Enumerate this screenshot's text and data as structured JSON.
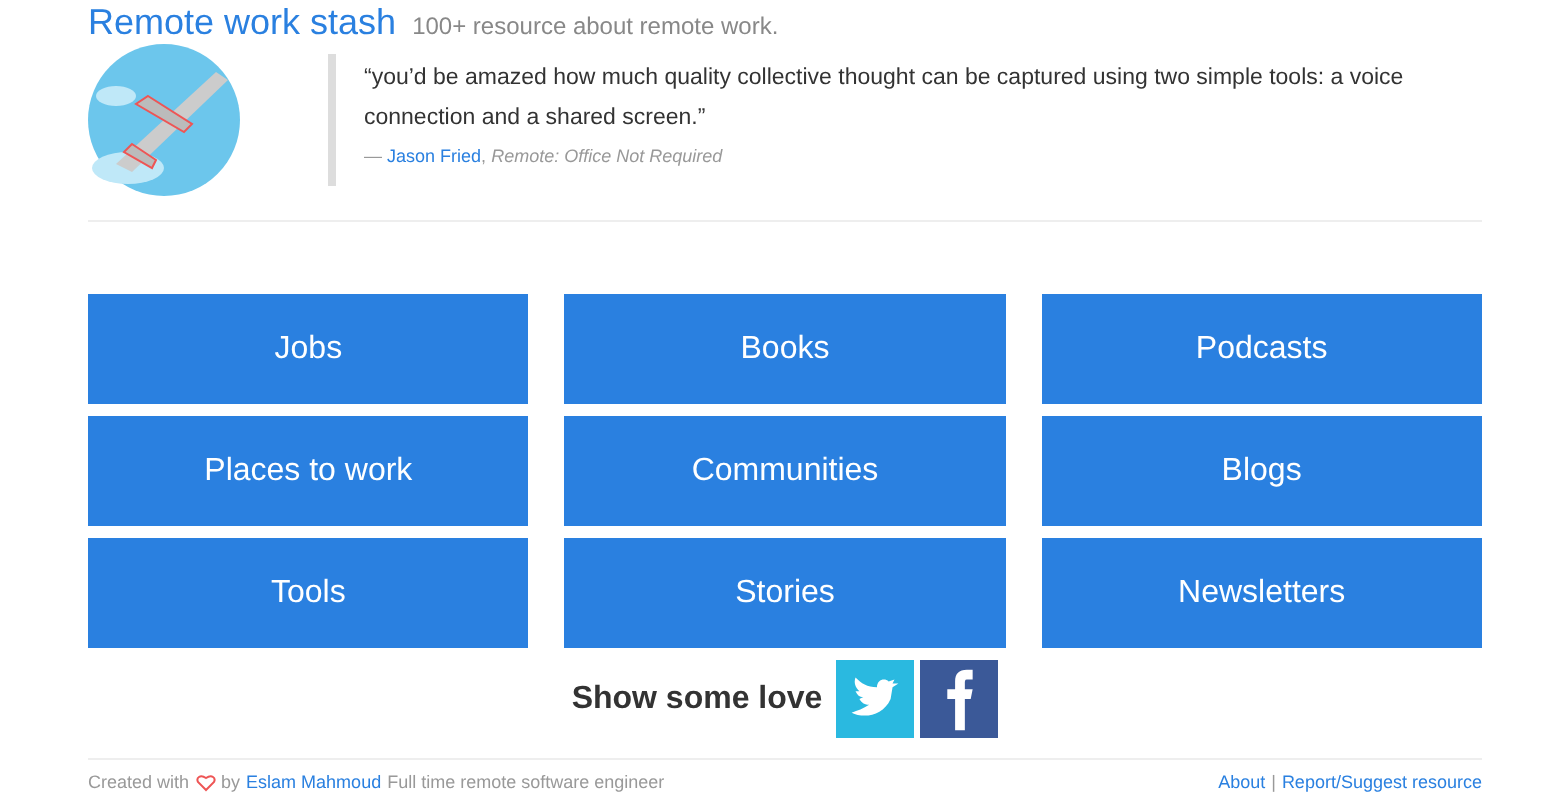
{
  "header": {
    "title": "Remote work stash",
    "subtitle": "100+ resource about remote work."
  },
  "quote": {
    "text": "“you’d be amazed how much quality collective thought can be captured using two simple tools: a voice connection and a shared screen.”",
    "dash": "—",
    "author": "Jason Fried",
    "comma": ",",
    "source": "Remote: Office Not Required"
  },
  "categories": [
    "Jobs",
    "Books",
    "Podcasts",
    "Places to work",
    "Communities",
    "Blogs",
    "Tools",
    "Stories",
    "Newsletters"
  ],
  "share": {
    "label": "Show some love"
  },
  "footer": {
    "created": "Created with",
    "by": "by",
    "author": "Eslam Mahmoud",
    "tagline": "Full time remote software engineer",
    "links": [
      "About",
      "Report/Suggest resource"
    ],
    "separator": "|"
  }
}
